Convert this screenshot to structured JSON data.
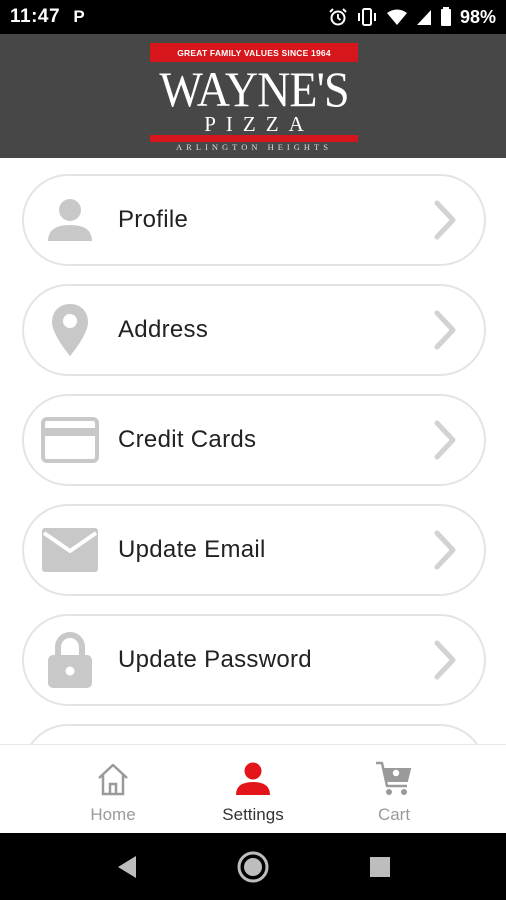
{
  "status_bar": {
    "time": "11:47",
    "app_indicator": "P",
    "battery": "98%"
  },
  "header": {
    "logo": {
      "tagline": "GREAT FAMILY VALUES SINCE 1964",
      "title": "WAYNE'S",
      "subtitle": "PIZZA",
      "location": "ARLINGTON HEIGHTS"
    }
  },
  "menu": {
    "items": [
      {
        "label": "Profile",
        "icon": "person-icon"
      },
      {
        "label": "Address",
        "icon": "location-pin-icon"
      },
      {
        "label": "Credit Cards",
        "icon": "credit-card-icon"
      },
      {
        "label": "Update Email",
        "icon": "envelope-icon"
      },
      {
        "label": "Update Password",
        "icon": "lock-icon"
      }
    ]
  },
  "bottom_nav": {
    "items": [
      {
        "label": "Home",
        "icon": "home-icon",
        "active": false
      },
      {
        "label": "Settings",
        "icon": "person-icon",
        "active": true
      },
      {
        "label": "Cart",
        "icon": "cart-icon",
        "active": false
      }
    ]
  },
  "colors": {
    "header_bg": "#474747",
    "brand_red": "#d6161b",
    "icon_gray": "#c8c8c8",
    "active_red": "#e3141a"
  }
}
